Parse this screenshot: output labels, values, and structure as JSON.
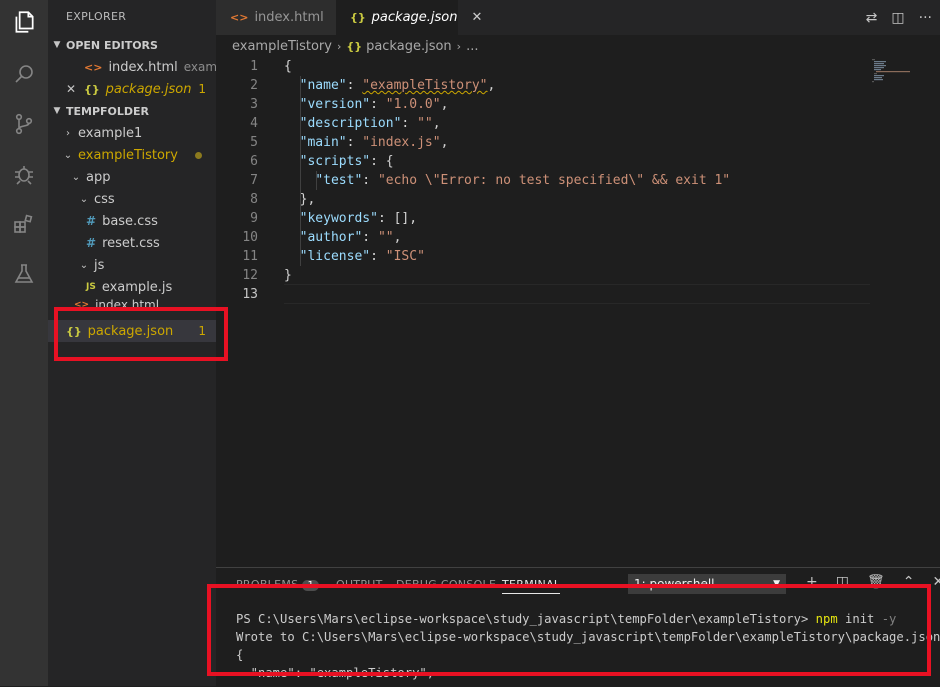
{
  "sidebar": {
    "title": "EXPLORER",
    "open_editors": {
      "label": "OPEN EDITORS",
      "items": [
        {
          "name": "index.html",
          "desc": "exampl..."
        },
        {
          "name": "package.json",
          "badge": "1"
        }
      ]
    },
    "folder": {
      "label": "TEMPFOLDER",
      "items": {
        "example1": "example1",
        "exampleTistory": "exampleTistory",
        "app": "app",
        "css": "css",
        "base_css": "base.css",
        "reset_css": "reset.css",
        "js": "js",
        "example_js": "example.js",
        "index_html": "index.html",
        "package_json": "package.json",
        "package_badge": "1"
      }
    }
  },
  "tabs": [
    {
      "label": "index.html"
    },
    {
      "label": "package.json"
    }
  ],
  "breadcrumb": [
    "exampleTistory",
    "package.json",
    "..."
  ],
  "editor": {
    "lines": [
      {
        "n": "1",
        "indent": "",
        "key": "",
        "val": "",
        "tail": "{"
      },
      {
        "n": "2",
        "indent": "  ",
        "key": "\"name\"",
        "val": "\"exampleTistory\"",
        "tail": ","
      },
      {
        "n": "3",
        "indent": "  ",
        "key": "\"version\"",
        "val": "\"1.0.0\"",
        "tail": ","
      },
      {
        "n": "4",
        "indent": "  ",
        "key": "\"description\"",
        "val": "\"\"",
        "tail": ","
      },
      {
        "n": "5",
        "indent": "  ",
        "key": "\"main\"",
        "val": "\"index.js\"",
        "tail": ","
      },
      {
        "n": "6",
        "indent": "  ",
        "key": "\"scripts\"",
        "val": "",
        "tail": ": {"
      },
      {
        "n": "7",
        "indent": "    ",
        "key": "\"test\"",
        "val": "\"echo \\\"Error: no test specified\\\" && exit 1\"",
        "tail": ""
      },
      {
        "n": "8",
        "indent": "  ",
        "key": "",
        "val": "",
        "tail": "},"
      },
      {
        "n": "9",
        "indent": "  ",
        "key": "\"keywords\"",
        "val": "",
        "tail": ": [],"
      },
      {
        "n": "10",
        "indent": "  ",
        "key": "\"author\"",
        "val": "\"\"",
        "tail": ","
      },
      {
        "n": "11",
        "indent": "  ",
        "key": "\"license\"",
        "val": "\"ISC\"",
        "tail": ""
      },
      {
        "n": "12",
        "indent": "",
        "key": "",
        "val": "",
        "tail": "}"
      },
      {
        "n": "13",
        "indent": "",
        "key": "",
        "val": "",
        "tail": ""
      }
    ]
  },
  "panel": {
    "tabs": {
      "problems": "PROBLEMS",
      "problems_badge": "1",
      "output": "OUTPUT",
      "debug": "DEBUG CONSOLE",
      "terminal": "TERMINAL"
    },
    "terminal_select": "1: powershell",
    "terminal": {
      "prompt": "PS C:\\Users\\Mars\\eclipse-workspace\\study_javascript\\tempFolder\\exampleTistory> ",
      "cmd": "npm",
      "args": " init ",
      "flag": "-y",
      "line2": "Wrote to C:\\Users\\Mars\\eclipse-workspace\\study_javascript\\tempFolder\\exampleTistory\\package.json:",
      "line3": "",
      "line4": "{",
      "line5": "  \"name\": \"exampleTistory\","
    }
  },
  "colors": {
    "highlight_box": "#e81123",
    "modified": "#cca700"
  }
}
